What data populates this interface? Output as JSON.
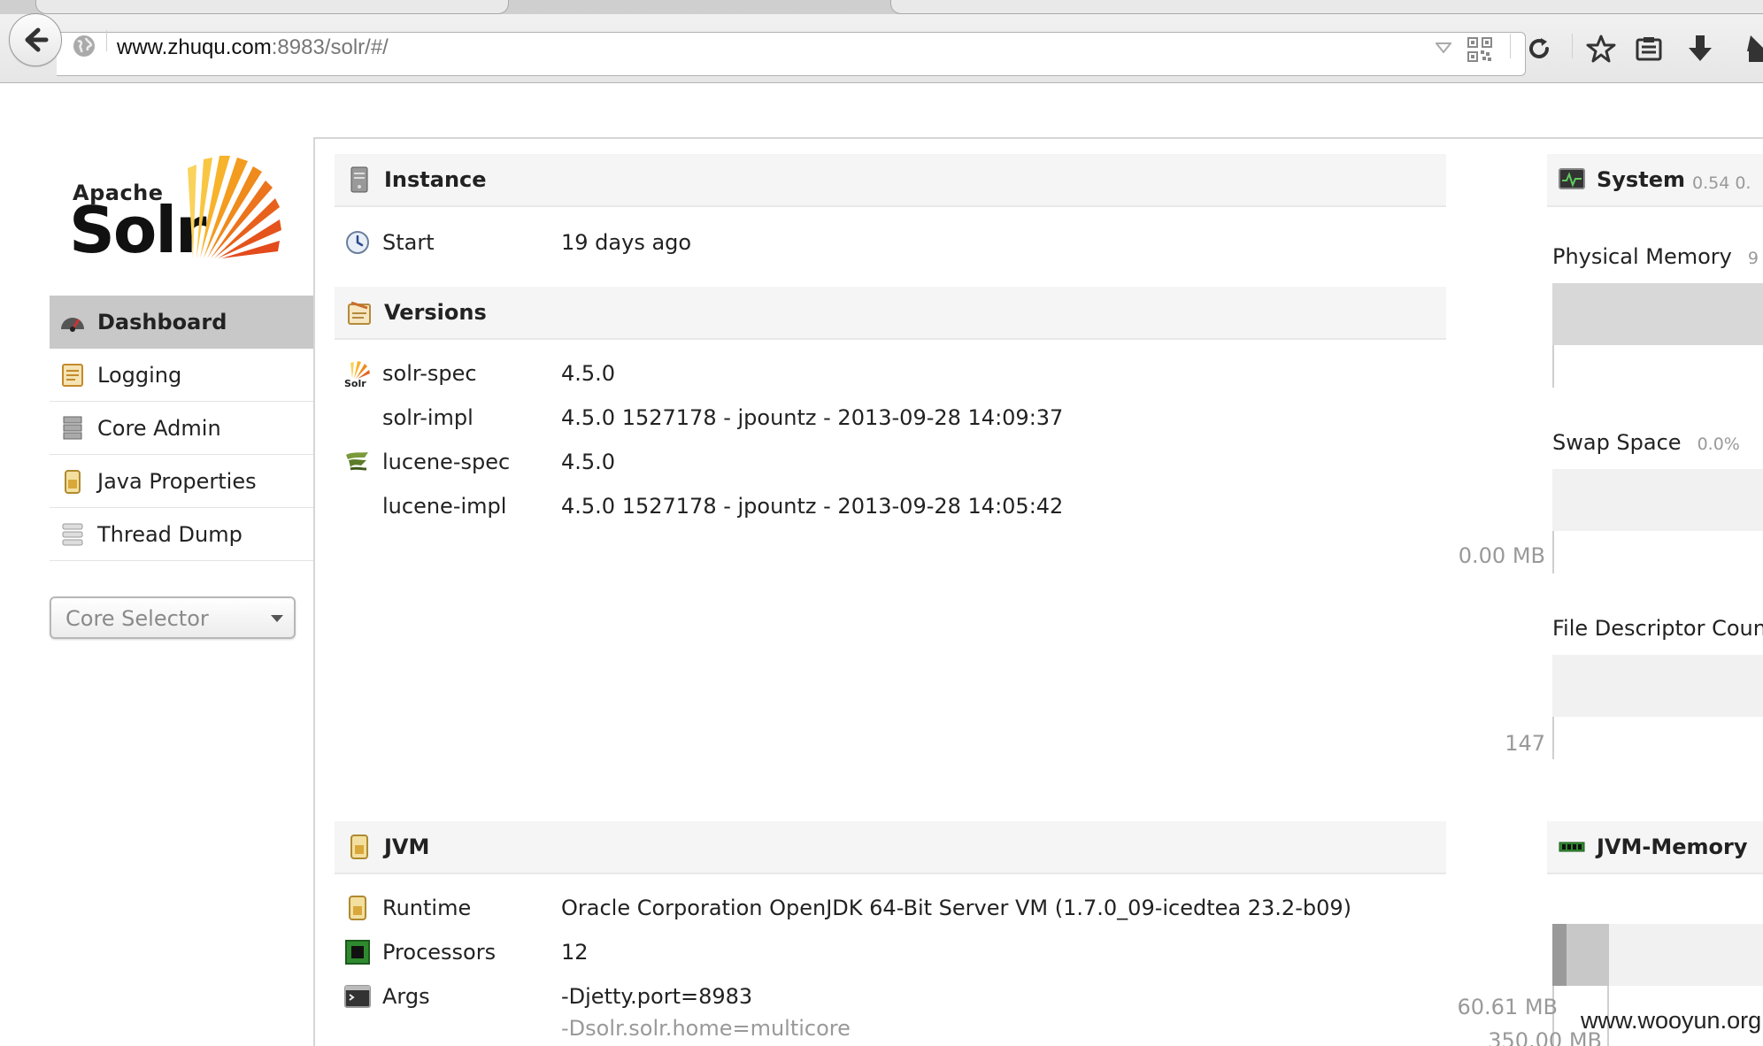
{
  "browser": {
    "url_host": "www.zhuqu.com",
    "url_rest": ":8983/solr/#/"
  },
  "logo": {
    "apache": "Apache",
    "solr": "Solr"
  },
  "nav": [
    {
      "label": "Dashboard",
      "icon": "dashboard-icon",
      "active": true
    },
    {
      "label": "Logging",
      "icon": "logging-icon"
    },
    {
      "label": "Core Admin",
      "icon": "core-admin-icon"
    },
    {
      "label": "Java Properties",
      "icon": "java-properties-icon"
    },
    {
      "label": "Thread Dump",
      "icon": "thread-dump-icon"
    }
  ],
  "core_selector": {
    "placeholder": "Core Selector"
  },
  "instance": {
    "title": "Instance",
    "start_label": "Start",
    "start_value": "19 days ago"
  },
  "versions": {
    "title": "Versions",
    "rows": [
      {
        "label": "solr-spec",
        "value": "4.5.0"
      },
      {
        "label": "solr-impl",
        "value": "4.5.0 1527178 - jpountz - 2013-09-28 14:09:37"
      },
      {
        "label": "lucene-spec",
        "value": "4.5.0"
      },
      {
        "label": "lucene-impl",
        "value": "4.5.0 1527178 - jpountz - 2013-09-28 14:05:42"
      }
    ]
  },
  "jvm": {
    "title": "JVM",
    "runtime_label": "Runtime",
    "runtime_value": "Oracle Corporation OpenJDK 64-Bit Server VM (1.7.0_09-icedtea 23.2-b09)",
    "processors_label": "Processors",
    "processors_value": "12",
    "args_label": "Args",
    "args": [
      "-Djetty.port=8983",
      "-Dsolr.solr.home=multicore"
    ]
  },
  "system": {
    "title": "System",
    "load": "0.54  0.",
    "physical_memory_label": "Physical Memory",
    "physical_memory_pct": "9",
    "swap_label": "Swap Space",
    "swap_pct": "0.0%",
    "swap_axis": "0.00 MB",
    "file_desc_label": "File Descriptor Coun",
    "file_desc_axis": "147"
  },
  "jvm_memory": {
    "title": "JVM-Memory",
    "used": "60.61 MB",
    "next": "350.00 MB"
  },
  "watermark": "www.wooyun.org"
}
